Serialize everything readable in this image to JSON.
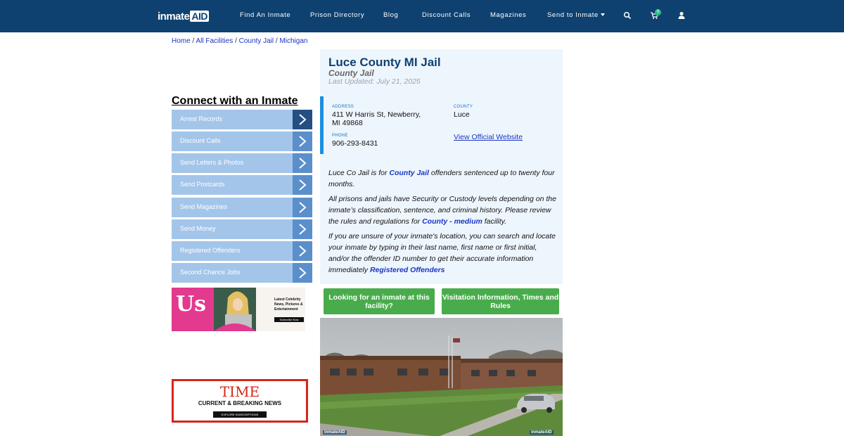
{
  "brand": {
    "logo_text": "inmate",
    "logo_box": "AID"
  },
  "nav": {
    "items": [
      "Find An Inmate",
      "Prison Directory",
      "Blog",
      "Discount Calls",
      "Magazines",
      "Send to Inmate"
    ],
    "cart_count": "0"
  },
  "breadcrumb": {
    "items": [
      "Home",
      "All Facilities",
      "County Jail",
      "Michigan"
    ],
    "separator": "/"
  },
  "sidebar": {
    "title": "Connect with an Inmate",
    "items": [
      "Arrest Records",
      "Discount Calls",
      "Send Letters & Photos",
      "Send Postcards",
      "Send Magazines",
      "Send Money",
      "Registered Offenders",
      "Second Chance Jobs"
    ]
  },
  "ads": {
    "us": {
      "logo": "Us",
      "text": "Latest Celebrity News, Pictures & Entertainment",
      "button": "Subscribe Now"
    },
    "time": {
      "logo": "TIME",
      "subtitle": "CURRENT & BREAKING NEWS",
      "button": "EXPLORE SUBSCRIPTIONS"
    }
  },
  "facility": {
    "name": "Luce County MI Jail",
    "type": "County Jail",
    "updated": "Last Updated: July 21, 2025",
    "address_label": "ADDRESS",
    "address_line1": "411 W Harris St, Newberry,",
    "address_line2": "MI 49868",
    "county_label": "COUNTY",
    "county": "Luce",
    "phone_label": "PHONE",
    "phone": "906-293-8431",
    "website_link": "View Official Website"
  },
  "description": {
    "p1_before": "Luce Co Jail is for ",
    "p1_link": "County Jail",
    "p1_after": " offenders sentenced up to twenty four months.",
    "p2_before": "All prisons and jails have Security or Custody levels depending on the inmate’s classification, sentence, and criminal history. Please review the rules and regulations for ",
    "p2_link": "County - medium",
    "p2_after": " facility.",
    "p3_before": "If you are unsure of your inmate's location, you can search and locate your inmate by typing in their last name, first name or first initial, and/or the offender ID number to get their accurate information immediately ",
    "p3_link": "Registered Offenders"
  },
  "buttons": {
    "find_inmate": "Looking for an inmate at this facility?",
    "visitation": "Visitation Information, Times and Rules"
  },
  "photo": {
    "watermark": "inmateAID"
  },
  "colors": {
    "navbar": "#0e4170",
    "menu": "#a4c5ea",
    "menu_arrow": "#5b8fcc",
    "green": "#49ac4c",
    "card_bg": "#eef6fd",
    "link": "#1a35c4"
  }
}
